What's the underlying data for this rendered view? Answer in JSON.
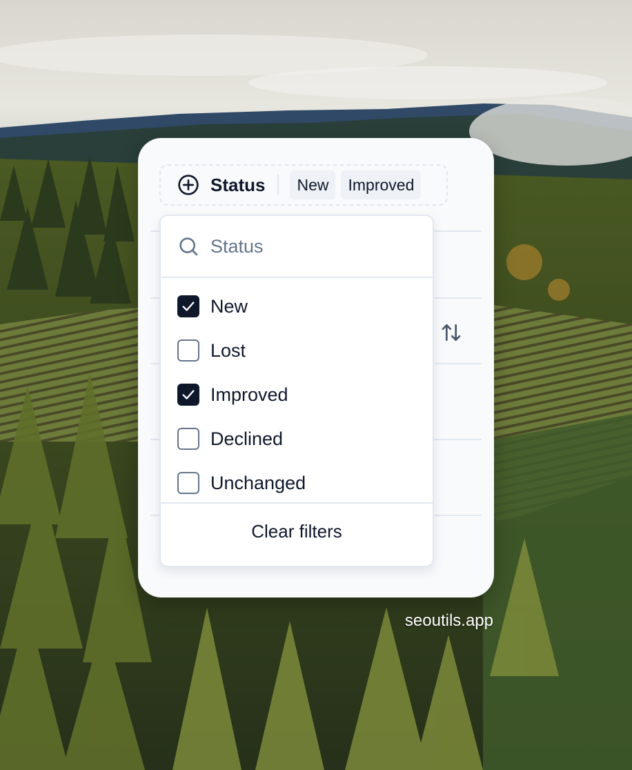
{
  "filter": {
    "label": "Status",
    "selected_badges": [
      "New",
      "Improved"
    ]
  },
  "search": {
    "placeholder": "Status",
    "value": ""
  },
  "options": [
    {
      "label": "New",
      "checked": true
    },
    {
      "label": "Lost",
      "checked": false
    },
    {
      "label": "Improved",
      "checked": true
    },
    {
      "label": "Declined",
      "checked": false
    },
    {
      "label": "Unchanged",
      "checked": false
    }
  ],
  "clear_label": "Clear filters",
  "watermark": "seoutils.app",
  "colors": {
    "primary": "#0f172a",
    "muted": "#64748b",
    "border": "#e2e8f0",
    "card_bg": "#f8fafc",
    "badge_bg": "#eef2f6"
  },
  "icons": {
    "filter": "plus-circle-icon",
    "search": "search-icon",
    "check": "check-icon",
    "sort": "arrow-up-down-icon"
  }
}
